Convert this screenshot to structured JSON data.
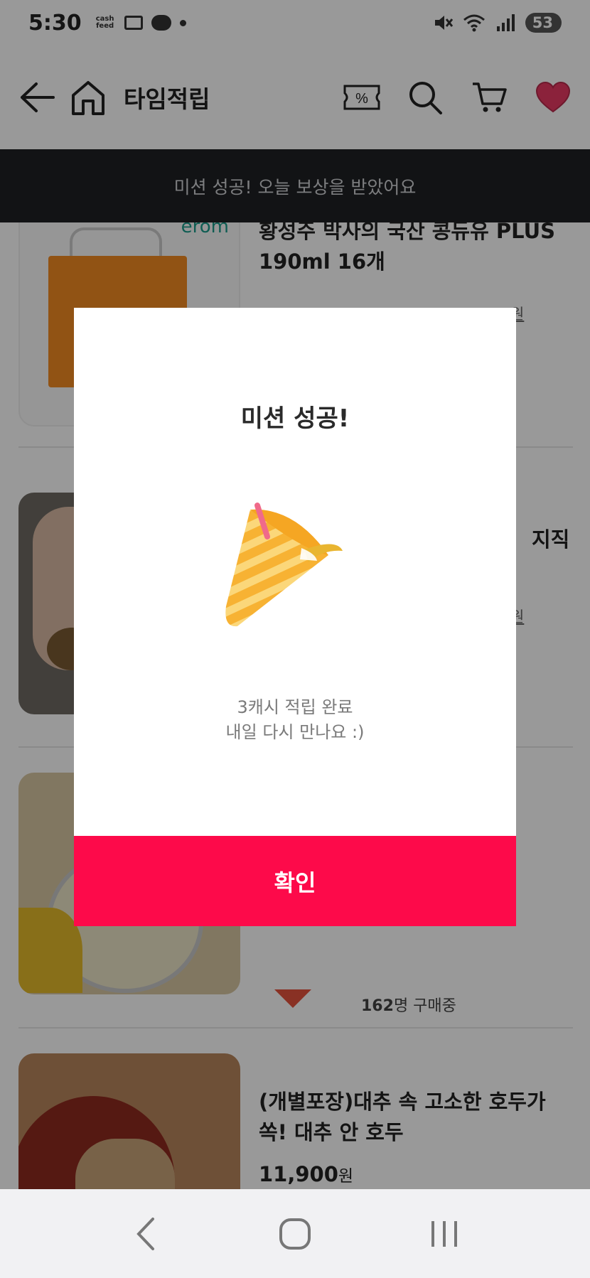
{
  "status_bar": {
    "time": "5:30",
    "notif_app": "cash feed",
    "battery": "53"
  },
  "header": {
    "title": "타임적립",
    "coupon_symbol": "%"
  },
  "banner": {
    "text": "미션 성공! 오늘 보상을 받았어요"
  },
  "products": [
    {
      "brand_logo": "erom",
      "name": "황성주 박사의 국산 콩듀유 PLUS\n190ml 16개",
      "partial_price_tail": "원"
    },
    {
      "name_fragment": "지직",
      "partial_price_tail": "원"
    },
    {
      "buyers_count": "162",
      "buyers_suffix": "명 구매중"
    },
    {
      "name": "(개별포장)대추 속 고소한 호두가\n쏙! 대추 안 호두",
      "price": "11,900",
      "price_unit": "원"
    }
  ],
  "modal": {
    "title": "미션 성공!",
    "line1": "3캐시 적립 완료",
    "line2": "내일 다시 만나요 :)",
    "confirm_label": "확인"
  },
  "colors": {
    "accent": "#fd0a4a",
    "banner_bg": "#1f2023",
    "heart": "#e83a63"
  }
}
